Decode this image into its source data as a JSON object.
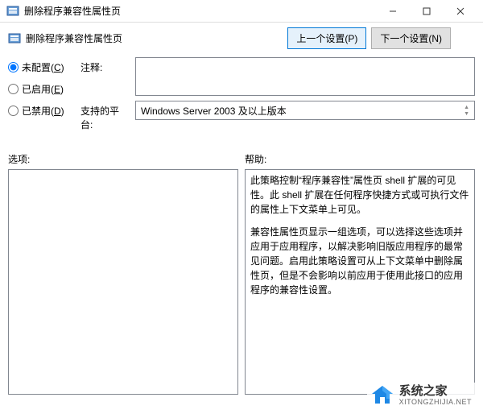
{
  "titlebar": {
    "title": "删除程序兼容性属性页"
  },
  "header": {
    "title": "删除程序兼容性属性页"
  },
  "nav": {
    "prev": "上一个设置(P)",
    "next": "下一个设置(N)"
  },
  "radios": {
    "not_configured": "未配置(C)",
    "enabled": "已启用(E)",
    "disabled": "已禁用(D)"
  },
  "fields": {
    "comment_label": "注释:",
    "comment_value": "",
    "platform_label": "支持的平台:",
    "platform_value": "Windows Server 2003 及以上版本"
  },
  "lower": {
    "options_label": "选项:",
    "help_label": "帮助:",
    "help_p1": "此策略控制“程序兼容性”属性页 shell 扩展的可见性。此 shell 扩展在任何程序快捷方式或可执行文件的属性上下文菜单上可见。",
    "help_p2": "兼容性属性页显示一组选项，可以选择这些选项并应用于应用程序，以解决影响旧版应用程序的最常见问题。启用此策略设置可从上下文菜单中删除属性页，但是不会影响以前应用于使用此接口的应用程序的兼容性设置。"
  },
  "watermark": {
    "title": "系统之家",
    "url": "XITONGZHIJIA.NET"
  }
}
